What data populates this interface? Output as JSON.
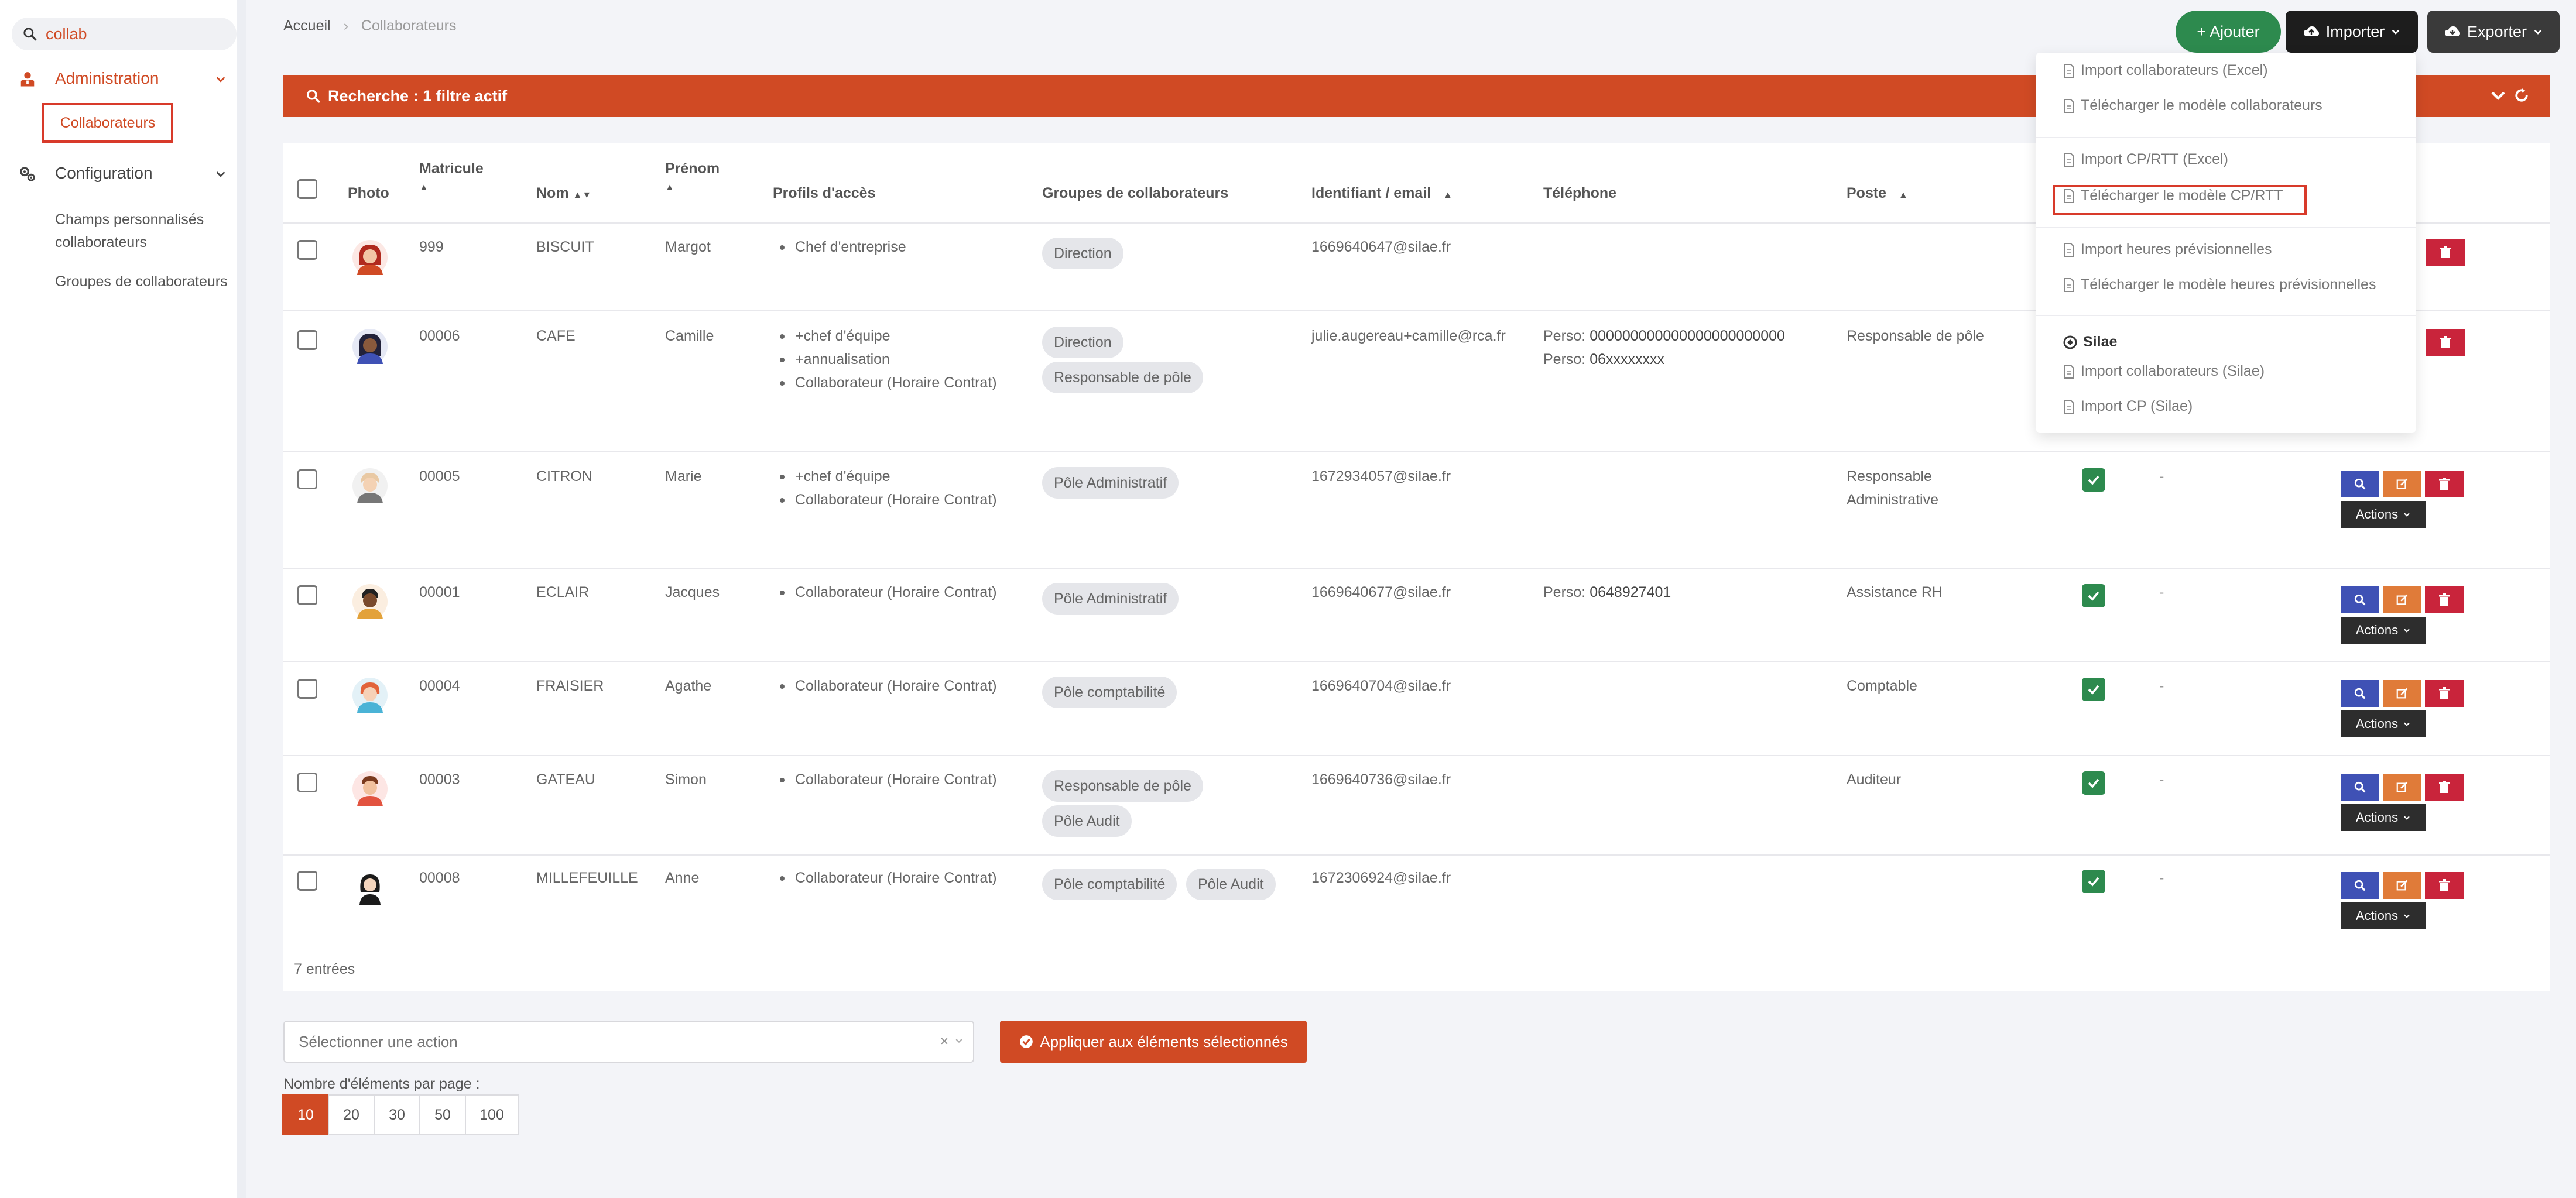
{
  "sidebar": {
    "search_value": "collab",
    "groups": [
      {
        "label": "Administration",
        "items": [
          "Collaborateurs"
        ]
      },
      {
        "label": "Configuration",
        "items": [
          "Champs personnalisés collaborateurs",
          "Groupes de collaborateurs"
        ]
      }
    ]
  },
  "breadcrumb": {
    "home": "Accueil",
    "separator": "›",
    "current": "Collaborateurs"
  },
  "toolbar": {
    "add_label": "+ Ajouter",
    "import_label": "Importer",
    "export_label": "Exporter"
  },
  "filter_bar": {
    "label": "Recherche : 1 filtre actif"
  },
  "import_menu": {
    "items": [
      "Import collaborateurs (Excel)",
      "Télécharger le modèle collaborateurs",
      "Import CP/RTT (Excel)",
      "Télécharger le modèle CP/RTT",
      "Import heures prévisionnelles",
      "Télécharger le modèle heures prévisionnelles",
      "Import collaborateurs (Silae)",
      "Import CP (Silae)"
    ],
    "section_header": "Silae"
  },
  "table": {
    "headers": {
      "photo": "Photo",
      "matricule": "Matricule",
      "nom": "Nom",
      "prenom": "Prénom",
      "profils": "Profils d'accès",
      "groupes": "Groupes de collaborateurs",
      "identifiant": "Identifiant / email",
      "telephone": "Téléphone",
      "poste": "Poste"
    },
    "phone_prefix": "Perso:",
    "rows": [
      {
        "matricule": "999",
        "nom": "BISCUIT",
        "prenom": "Margot",
        "profils": [
          "Chef d'entreprise"
        ],
        "groupes": [
          "Direction"
        ],
        "email": "1669640647@silae.fr",
        "phones": [],
        "poste": "",
        "active": null,
        "dash": ""
      },
      {
        "matricule": "00006",
        "nom": "CAFE",
        "prenom": "Camille",
        "profils": [
          "+chef d'équipe",
          "+annualisation",
          "Collaborateur (Horaire Contrat)"
        ],
        "groupes": [
          "Direction",
          "Responsable de pôle"
        ],
        "email": "julie.augereau+camille@rca.fr",
        "phones": [
          "000000000000000000000000",
          "06xxxxxxxx"
        ],
        "poste": "Responsable de pôle",
        "active": null,
        "dash": ""
      },
      {
        "matricule": "00005",
        "nom": "CITRON",
        "prenom": "Marie",
        "profils": [
          "+chef d'équipe",
          "Collaborateur (Horaire Contrat)"
        ],
        "groupes": [
          "Pôle Administratif"
        ],
        "email": "1672934057@silae.fr",
        "phones": [],
        "poste": "Responsable Administrative",
        "active": true,
        "dash": "-"
      },
      {
        "matricule": "00001",
        "nom": "ECLAIR",
        "prenom": "Jacques",
        "profils": [
          "Collaborateur (Horaire Contrat)"
        ],
        "groupes": [
          "Pôle Administratif"
        ],
        "email": "1669640677@silae.fr",
        "phones": [
          "0648927401"
        ],
        "poste": "Assistance RH",
        "active": true,
        "dash": "-"
      },
      {
        "matricule": "00004",
        "nom": "FRAISIER",
        "prenom": "Agathe",
        "profils": [
          "Collaborateur (Horaire Contrat)"
        ],
        "groupes": [
          "Pôle comptabilité"
        ],
        "email": "1669640704@silae.fr",
        "phones": [],
        "poste": "Comptable",
        "active": true,
        "dash": "-"
      },
      {
        "matricule": "00003",
        "nom": "GATEAU",
        "prenom": "Simon",
        "profils": [
          "Collaborateur (Horaire Contrat)"
        ],
        "groupes": [
          "Responsable de pôle",
          "Pôle Audit"
        ],
        "email": "1669640736@silae.fr",
        "phones": [],
        "poste": "Auditeur",
        "active": true,
        "dash": "-"
      },
      {
        "matricule": "00008",
        "nom": "MILLEFEUILLE",
        "prenom": "Anne",
        "profils": [
          "Collaborateur (Horaire Contrat)"
        ],
        "groupes": [
          "Pôle comptabilité",
          "Pôle Audit"
        ],
        "email": "1672306924@silae.fr",
        "phones": [],
        "poste": "",
        "active": true,
        "dash": "-"
      }
    ],
    "actions_label": "Actions",
    "entries_text": "7 entrées"
  },
  "bulk": {
    "select_placeholder": "Sélectionner une action",
    "clear": "×",
    "apply_label": "Appliquer aux éléments sélectionnés"
  },
  "pagination": {
    "label": "Nombre d'éléments par page :",
    "options": [
      "10",
      "20",
      "30",
      "50",
      "100"
    ],
    "selected": "10"
  },
  "colors": {
    "accent": "#d04a24",
    "success": "#2d8a4e",
    "primary": "#3f51b5",
    "warning": "#e07b39",
    "danger": "#c9243b"
  }
}
